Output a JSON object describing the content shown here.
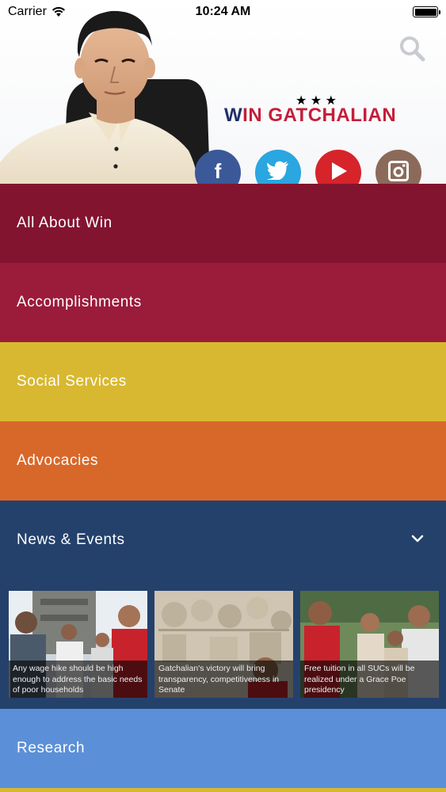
{
  "status_bar": {
    "carrier": "Carrier",
    "time": "10:24 AM"
  },
  "header": {
    "logo_stars": "★ ★ ★",
    "logo_text_w": "W",
    "logo_text_rest": "IN GATCHALIAN",
    "social": {
      "facebook": "f",
      "twitter_icon": "twitter-bird",
      "youtube_icon": "play",
      "instagram_icon": "camera"
    }
  },
  "menu": {
    "items": [
      {
        "label": "All About Win",
        "color": "#83142f"
      },
      {
        "label": "Accomplishments",
        "color": "#9b1b3a"
      },
      {
        "label": "Social Services",
        "color": "#d8b830"
      },
      {
        "label": "Advocacies",
        "color": "#d8682a"
      }
    ],
    "news": {
      "label": "News & Events",
      "color": "#24416c",
      "cards": [
        {
          "caption": "Any wage hike should be high enough to address the basic needs of poor households"
        },
        {
          "caption": "Gatchalian's victory will bring transparency, competitiveness in Senate"
        },
        {
          "caption": "Free tuition in all SUCs will be realized under a Grace Poe presidency"
        }
      ]
    },
    "research": {
      "label": "Research",
      "color": "#5b90d8"
    }
  },
  "colors": {
    "brand_red": "#c41e3a",
    "brand_navy": "#1f2f6b",
    "star_yellow": "#f2c400"
  }
}
